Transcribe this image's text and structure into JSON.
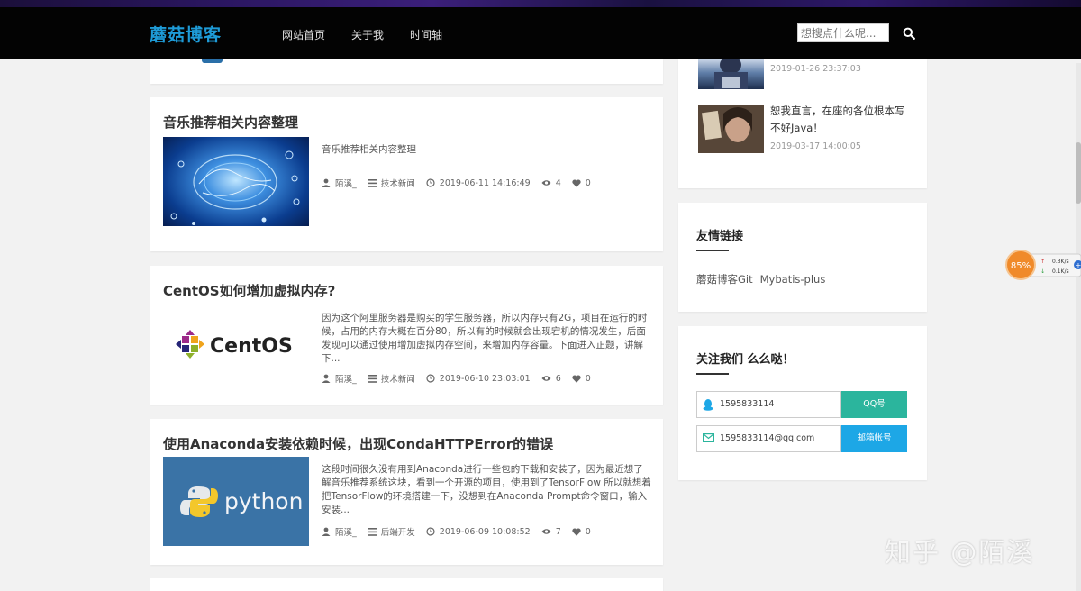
{
  "header": {
    "logo": "蘑菇博客",
    "nav": [
      "网站首页",
      "关于我",
      "时间轴"
    ],
    "search_placeholder": "想搜点什么呢..."
  },
  "posts": [
    {
      "title": "音乐推荐相关内容整理",
      "excerpt": "音乐推荐相关内容整理",
      "author": "陌溪_",
      "category": "技术新闻",
      "date": "2019-06-11 14:16:49",
      "views": "4",
      "likes": "0"
    },
    {
      "title": "CentOS如何增加虚拟内存?",
      "excerpt": "因为这个阿里服务器是购买的学生服务器，所以内存只有2G，项目在运行的时候，占用的内存大概在百分80，所以有的时候就会出现宕机的情况发生，后面发现可以通过使用增加虚拟内存空间，来增加内存容量。下面进入正题，讲解下...",
      "thumb_text": "CentOS",
      "author": "陌溪_",
      "category": "技术新闻",
      "date": "2019-06-10 23:03:01",
      "views": "6",
      "likes": "0"
    },
    {
      "title": "使用Anaconda安装依赖时候，出现CondaHTTPError的错误",
      "excerpt": "这段时间很久没有用到Anaconda进行一些包的下载和安装了，因为最近想了解音乐推荐系统这块，看到一个开源的项目，使用到了TensorFlow 所以就想着把TensorFlow的环境搭建一下，没想到在Anaconda Prompt命令窗口，输入安装...",
      "thumb_text": "python",
      "author": "陌溪_",
      "category": "后端开发",
      "date": "2019-06-09 10:08:52",
      "views": "7",
      "likes": "0"
    }
  ],
  "sidebar": {
    "recent": [
      {
        "title": "",
        "date": "2019-01-26 23:37:03"
      },
      {
        "title": "恕我直言，在座的各位根本写不好Java！",
        "date": "2019-03-17 14:00:05"
      }
    ],
    "links_title": "友情链接",
    "links": [
      "蘑菇博客Git",
      "Mybatis-plus"
    ],
    "follow_title": "关注我们 么么哒！",
    "qq_value": "1595833114",
    "qq_button": "QQ号",
    "email_value": "1595833114@qq.com",
    "email_button": "邮箱帐号"
  },
  "widget": {
    "percent": "85%",
    "upload": "0.3K/s",
    "download": "0.1K/s"
  },
  "watermark": "知乎 @陌溪",
  "colors": {
    "logo": "#1e9bd7",
    "qq_button": "#2bb59d",
    "email_button": "#1da7e6"
  }
}
